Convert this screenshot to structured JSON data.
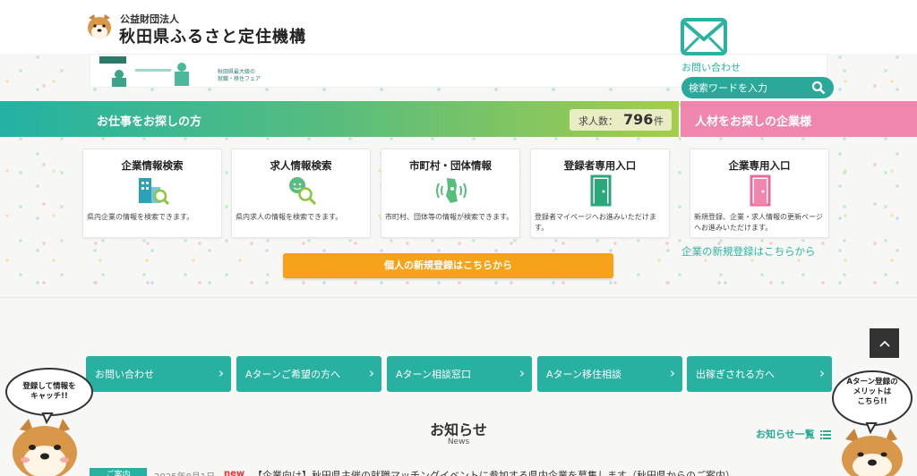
{
  "header": {
    "logo_sub": "公益財団法人",
    "logo_main": "秋田県ふるさと定住機構"
  },
  "banner": {
    "caption": "秋田県最大級の\n就職・移住フェア"
  },
  "contact": {
    "label": "お問い合わせ"
  },
  "search": {
    "placeholder": "検索ワードを入力"
  },
  "job_band": {
    "title": "お仕事をお探しの方",
    "count_label": "求人数：",
    "count_value": "796",
    "count_unit": "件"
  },
  "corp_band": {
    "title": "人材をお探しの企業様"
  },
  "cards": [
    {
      "title": "企業情報検索",
      "desc": "県内企業の情報を検索できます。",
      "icon": "building-search-icon"
    },
    {
      "title": "求人情報検索",
      "desc": "県内求人の情報を検索できます。",
      "icon": "person-search-icon"
    },
    {
      "title": "市町村・団体情報",
      "desc": "市町村、団体等の情報が検索できます。",
      "icon": "akita-map-icon"
    },
    {
      "title": "登録者専用入口",
      "desc": "登録者マイページへお進みいただけます。",
      "icon": "door-icon"
    },
    {
      "title": "企業専用入口",
      "desc": "新規登録、企業・求人情報の更新ページへお進みいただけます。",
      "icon": "door-icon"
    }
  ],
  "register_button": "個人の新規登録はこちらから",
  "corp_register_link": "企業の新規登録はこちらから",
  "nav_buttons": [
    {
      "label": "お問い合わせ"
    },
    {
      "label": "Aターンご希望の方へ"
    },
    {
      "label": "Aターン相談窓口"
    },
    {
      "label": "Aターン移住相談"
    },
    {
      "label": "出稼ぎされる方へ"
    }
  ],
  "news": {
    "title": "お知らせ",
    "subtitle": "News",
    "list_link": "お知らせ一覧",
    "items": [
      {
        "category": "ご案内",
        "date": "2025年8月1日",
        "badge": "new",
        "text": "【企業向け】秋田県主催の就職マッチングイベントに参加する県内企業を募集します（秋田県からのご案内）"
      }
    ]
  },
  "mascots": {
    "left_bubble": "登録して情報を\nキャッチ!!",
    "right_bubble": "Aターン登録の\nメリットは\nこちら!!"
  },
  "colors": {
    "teal": "#28b0a0",
    "pink": "#ef86ad",
    "orange": "#f7a21b",
    "green_gradient_end": "#a5cd49"
  }
}
